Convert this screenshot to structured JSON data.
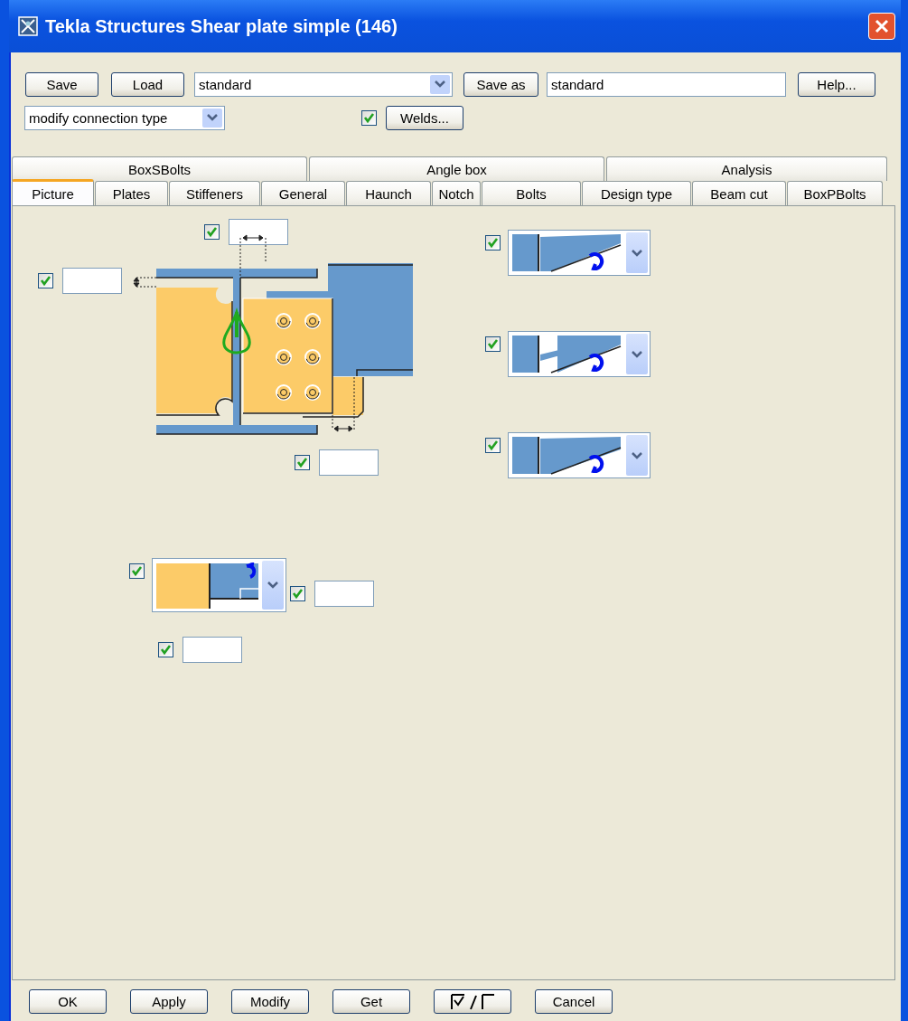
{
  "window": {
    "title": "Tekla Structures  Shear plate simple (146)"
  },
  "toolbar": {
    "save": "Save",
    "load": "Load",
    "preset": "standard",
    "save_as": "Save as",
    "save_as_name": "standard",
    "help": "Help...",
    "mode": "modify connection type",
    "welds_checked": true,
    "welds": "Welds..."
  },
  "tabs": {
    "back_row": [
      {
        "label": "BoxSBolts",
        "selected": false
      },
      {
        "label": "Angle box",
        "selected": false
      },
      {
        "label": "Analysis",
        "selected": false
      }
    ],
    "front_row": [
      {
        "label": "Picture",
        "selected": true
      },
      {
        "label": "Plates",
        "selected": false
      },
      {
        "label": "Stiffeners",
        "selected": false
      },
      {
        "label": "General",
        "selected": false
      },
      {
        "label": "Haunch",
        "selected": false
      },
      {
        "label": "Notch",
        "selected": false
      },
      {
        "label": "Bolts",
        "selected": false
      },
      {
        "label": "Design type",
        "selected": false
      },
      {
        "label": "Beam cut",
        "selected": false
      },
      {
        "label": "BoxPBolts",
        "selected": false
      }
    ]
  },
  "picture": {
    "fields": [
      {
        "checked": true
      },
      {
        "checked": true
      },
      {
        "checked": true
      },
      {
        "checked": true
      },
      {
        "checked": true
      }
    ],
    "profile_dropdowns": [
      {
        "checked": true
      },
      {
        "checked": true
      },
      {
        "checked": true
      }
    ],
    "corner_dropdown": {
      "checked": true
    }
  },
  "buttons": [
    {
      "kind": "text",
      "label": "OK"
    },
    {
      "kind": "text",
      "label": "Apply"
    },
    {
      "kind": "text",
      "label": "Modify"
    },
    {
      "kind": "text",
      "label": "Get"
    },
    {
      "kind": "toggle"
    },
    {
      "kind": "text",
      "label": "Cancel"
    }
  ]
}
